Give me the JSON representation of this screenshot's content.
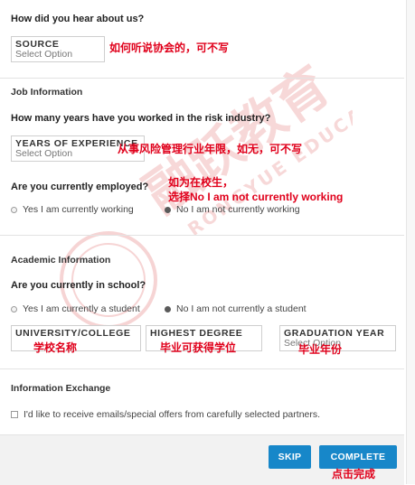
{
  "hear_about": {
    "question": "How did you hear about us?",
    "field_label": "SOURCE",
    "placeholder": "Select Option",
    "note": "如何听说协会的，可不写"
  },
  "job_info": {
    "section_title": "Job Information",
    "years_question": "How many years have you worked in the risk industry?",
    "years_field_label": "YEARS OF EXPERIENCE",
    "years_placeholder": "Select Option",
    "years_note": "从事风险管理行业年限，如无，可不写",
    "employed_question": "Are you currently employed?",
    "employed_note_line1": "如为在校生，",
    "employed_note_line2": "选择No I am not currently working",
    "employed_options": [
      {
        "label": "Yes I am currently working",
        "selected": false
      },
      {
        "label": "No I am not currently working",
        "selected": true
      }
    ]
  },
  "academic": {
    "section_title": "Academic Information",
    "school_question": "Are you currently in school?",
    "school_options": [
      {
        "label": "Yes I am currently a student",
        "selected": false
      },
      {
        "label": "No I am not currently a student",
        "selected": true
      }
    ],
    "university_label": "UNIVERSITY/COLLEGE",
    "university_note": "学校名称",
    "degree_label": "HIGHEST DEGREE",
    "degree_note": "毕业可获得学位",
    "grad_label": "GRADUATION YEAR",
    "grad_placeholder": "Select Option",
    "grad_note": "毕业年份"
  },
  "info_exchange": {
    "section_title": "Information Exchange",
    "optin_label": "I'd like to receive emails/special offers from carefully selected partners."
  },
  "footer": {
    "skip_label": "SKIP",
    "complete_label": "COMPLETE",
    "complete_note": "点击完成"
  },
  "watermark": {
    "text_main": "融跃教育",
    "text_sub": "RONGYUE EDUCATION"
  },
  "colors": {
    "accent_button": "#1787c9",
    "note_red": "#e0001b",
    "watermark_red": "#e06060"
  }
}
